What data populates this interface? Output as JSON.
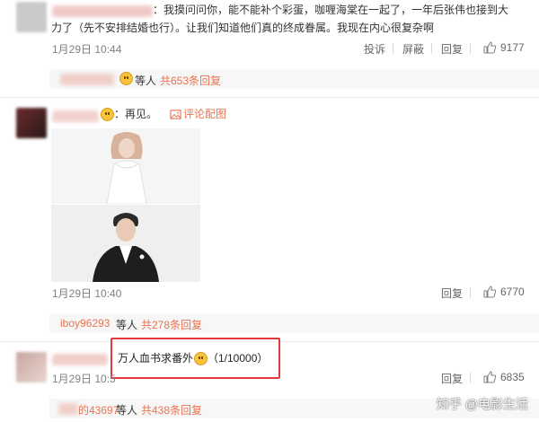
{
  "comment1": {
    "text_line1": "：我摸问问你，能不能补个彩蛋，咖喱海棠在一起了，一年后张伟也接到大",
    "text_line2": "力了（先不安排结婚也行）。让我们知道他们真的终成眷属。我现在内心很复杂啊",
    "timestamp": "1月29日 10:44",
    "actions": {
      "report": "投诉",
      "block": "屏蔽",
      "reply": "回复"
    },
    "likes": "9177",
    "reply_strip": {
      "suffix": "等人",
      "count_link": "共653条回复"
    }
  },
  "comment2": {
    "text": "：再见。",
    "image_link": "评论配图",
    "timestamp": "1月29日 10:40",
    "reply": "回复",
    "likes": "6770",
    "reply_strip": {
      "user": "iboy96293",
      "suffix": "等人",
      "count_link": "共278条回复"
    }
  },
  "comment3": {
    "text": "万人血书求番外",
    "counter": "（1/10000）",
    "timestamp": "1月29日 10:5",
    "reply": "回复",
    "likes": "6835",
    "reply_strip": {
      "user": "的43697",
      "suffix": "等人",
      "count_link": "共438条回复"
    }
  },
  "watermark": "知乎 @电影生活",
  "colors": {
    "accent": "#eb7350",
    "highlight": "#e4393c"
  }
}
